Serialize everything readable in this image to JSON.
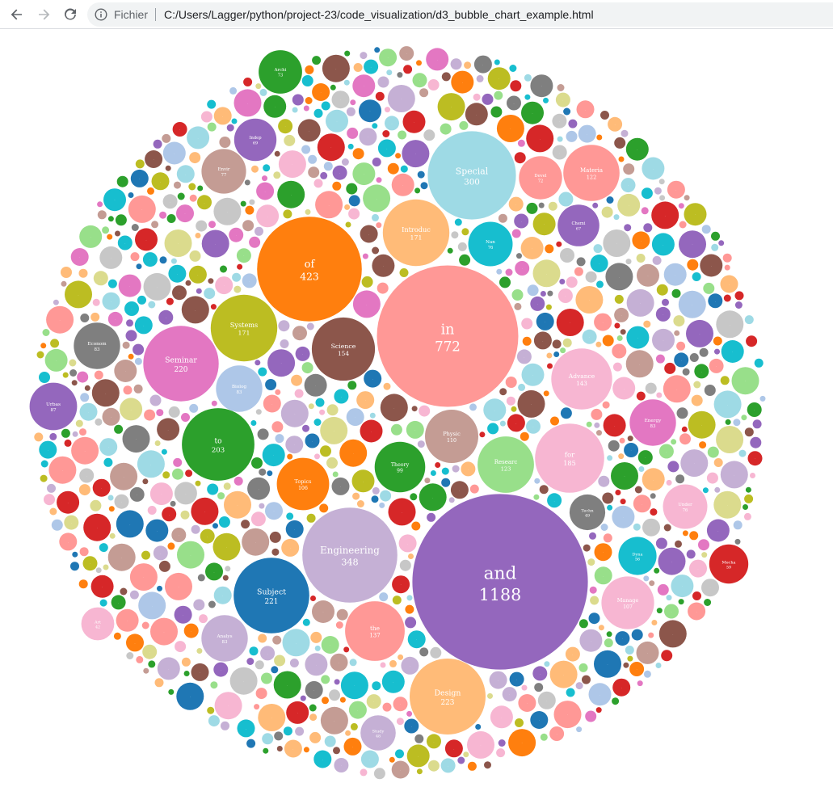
{
  "browser": {
    "scheme_label": "Fichier",
    "url": "C:/Users/Lagger/python/project-23/code_visualization/d3_bubble_chart_example.html",
    "icons": {
      "back": "back-arrow-icon",
      "forward": "forward-arrow-icon",
      "reload": "reload-icon",
      "info": "info-icon"
    }
  },
  "palette": [
    "#1f77b4",
    "#ff7f0e",
    "#2ca02c",
    "#d62728",
    "#9467bd",
    "#8c564b",
    "#e377c2",
    "#7f7f7f",
    "#bcbd22",
    "#17becf",
    "#aec7e8",
    "#ffbb78",
    "#98df8a",
    "#ff9896",
    "#c5b0d5",
    "#c49c94",
    "#f7b6d2",
    "#c7c7c7",
    "#dbdb8d",
    "#9edae5"
  ],
  "chart_data": {
    "type": "bubble",
    "bubbles": [
      {
        "label": "and",
        "value": 1188,
        "color": "#9467bd"
      },
      {
        "label": "in",
        "value": 772,
        "color": "#ff9896"
      },
      {
        "label": "of",
        "value": 423,
        "color": "#ff7f0e"
      },
      {
        "label": "Engineering",
        "value": 348,
        "color": "#c5b0d5"
      },
      {
        "label": "Special",
        "value": 300,
        "color": "#9edae5"
      },
      {
        "label": "Design",
        "value": 223,
        "color": "#ffbb78"
      },
      {
        "label": "Subject",
        "value": 221,
        "color": "#1f77b4"
      },
      {
        "label": "Seminar",
        "value": 220,
        "color": "#e377c2"
      },
      {
        "label": "to",
        "value": 203,
        "color": "#2ca02c"
      },
      {
        "label": "for",
        "value": 185,
        "color": "#f7b6d2"
      },
      {
        "label": "Introduc",
        "value": 171,
        "color": "#ffbb78"
      },
      {
        "label": "Systems",
        "value": 171,
        "color": "#bcbd22"
      },
      {
        "label": "Science",
        "value": 154,
        "color": "#8c564b"
      },
      {
        "label": "Advance",
        "value": 143,
        "color": "#f7b6d2"
      },
      {
        "label": "the",
        "value": 137,
        "color": "#ff9896"
      },
      {
        "label": "Researc",
        "value": 123,
        "color": "#98df8a"
      },
      {
        "label": "Materia",
        "value": 122,
        "color": "#ff9896"
      },
      {
        "label": "Physic",
        "value": 110,
        "color": "#c49c94"
      },
      {
        "label": "Manage",
        "value": 107,
        "color": "#f7b6d2"
      },
      {
        "label": "Topics",
        "value": 106,
        "color": "#ff7f0e"
      },
      {
        "label": "Theory",
        "value": 99,
        "color": "#2ca02c"
      },
      {
        "label": "Urbas",
        "value": 87,
        "color": "#9467bd"
      },
      {
        "label": "Econom",
        "value": 83,
        "color": "#7f7f7f"
      },
      {
        "label": "Energy",
        "value": 83,
        "color": "#e377c2"
      },
      {
        "label": "Biolog",
        "value": 83,
        "color": "#aec7e8"
      },
      {
        "label": "Analys",
        "value": 83,
        "color": "#c5b0d5"
      },
      {
        "label": "Archi",
        "value": 73,
        "color": "#2ca02c"
      },
      {
        "label": "Envir",
        "value": 77,
        "color": "#c49c94"
      },
      {
        "label": "Indep",
        "value": 69,
        "color": "#9467bd"
      },
      {
        "label": "Devel",
        "value": 72,
        "color": "#ff9896"
      },
      {
        "label": "Chemi",
        "value": 67,
        "color": "#9467bd"
      },
      {
        "label": "Nan",
        "value": 76,
        "color": "#17becf"
      },
      {
        "label": "Under",
        "value": 76,
        "color": "#f7b6d2"
      },
      {
        "label": "Mecha",
        "value": 59,
        "color": "#d62728"
      },
      {
        "label": "Dyna",
        "value": 56,
        "color": "#17becf"
      },
      {
        "label": "Techn",
        "value": 49,
        "color": "#7f7f7f"
      },
      {
        "label": "Study",
        "value": 48,
        "color": "#c5b0d5"
      },
      {
        "label": "Art",
        "value": 42,
        "color": "#f7b6d2"
      }
    ]
  }
}
